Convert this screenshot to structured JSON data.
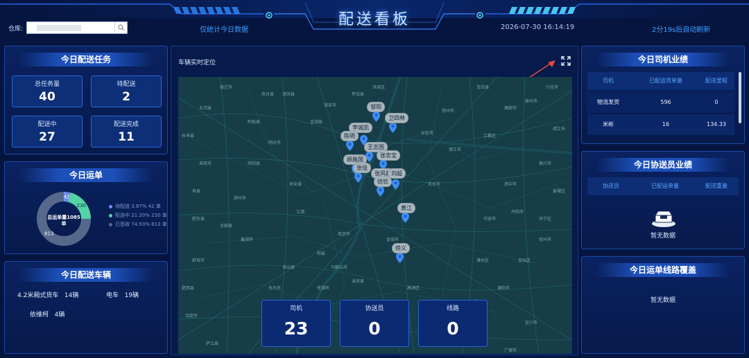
{
  "header": {
    "title": "配送看板",
    "warehouse_label": "仓库:",
    "warehouse_value": "",
    "stat_scope": "仅统计今日数据",
    "datetime": "2026-07-30 16:14:19",
    "refresh": "2分19s后自动刷新"
  },
  "tasks": {
    "title": "今日配送任务",
    "items": [
      {
        "label": "总任务量",
        "value": "40"
      },
      {
        "label": "待配送",
        "value": "2"
      },
      {
        "label": "配送中",
        "value": "27"
      },
      {
        "label": "配送完成",
        "value": "11"
      }
    ]
  },
  "waybill": {
    "title": "今日运单",
    "center_label": "总运单量1085单",
    "slices": [
      {
        "name": "待配送",
        "percent": "3.87%",
        "count": "42 单",
        "value": 42,
        "display": "42",
        "color": "#6e8df0"
      },
      {
        "name": "配送中",
        "percent": "21.20%",
        "count": "230 单",
        "value": 230,
        "display": "230",
        "color": "#53d3a6"
      },
      {
        "name": "已签收",
        "percent": "74.93%",
        "count": "813 单",
        "value": 813,
        "display": "813",
        "color": "#56698c"
      }
    ]
  },
  "vehicles": {
    "title": "今日配送车辆",
    "items": [
      {
        "name": "4.2米厢式货车",
        "count": "14辆"
      },
      {
        "name": "电车",
        "count": "19辆"
      },
      {
        "name": "依维柯",
        "count": "4辆"
      }
    ]
  },
  "map": {
    "title": "车辆实时定位",
    "cities": [
      "宿迁市",
      "淮安市",
      "扬州市",
      "泰州市",
      "镇江市",
      "常州市",
      "南京市",
      "马鞍山市",
      "芜湖市",
      "滁州市",
      "蚌埠市",
      "宣城市",
      "合肥市",
      "淮南市",
      "无为市",
      "巢湖市",
      "句容市",
      "仪征市",
      "天长市",
      "明光市",
      "来安县",
      "金湖县",
      "盱眙县",
      "江浦",
      "全椒县",
      "和县",
      "含山县",
      "当涂县",
      "溧水区",
      "高淳区",
      "溧阳市",
      "丹阳市",
      "金坛区",
      "宜兴市",
      "靖江市",
      "泰兴市",
      "江都区",
      "高邮市",
      "宝应县",
      "兴化市",
      "姜堰区",
      "扬中市",
      "天宁区",
      "肥东县",
      "肥西县",
      "庐江县",
      "南陵县",
      "繁昌县",
      "郎溪县",
      "广德市",
      "洪泽区",
      "泗洪县",
      "五河县",
      "凤阳县",
      "定远县",
      "长丰县",
      "寿县",
      "凤台县",
      "怀远县"
    ],
    "drivers": [
      "邹阳",
      "卫四林",
      "李城凯",
      "陈明",
      "王志国",
      "张忠宝",
      "顾胤国",
      "张佳",
      "张凤超",
      "刘超",
      "徐钦",
      "黄江",
      "徐义"
    ],
    "stats": [
      {
        "label": "司机",
        "value": "23"
      },
      {
        "label": "协送员",
        "value": "0"
      },
      {
        "label": "线路",
        "value": "0"
      }
    ]
  },
  "driver_perf": {
    "title": "今日司机业绩",
    "columns": [
      "司机",
      "已配运货单量",
      "配送里程"
    ],
    "rows": [
      [
        "物流发货",
        "596",
        "0"
      ],
      [
        "米彬",
        "16",
        "134.33"
      ]
    ]
  },
  "assistant_perf": {
    "title": "今日协送员业绩",
    "columns": [
      "协送员",
      "已配运单量",
      "配送重量"
    ],
    "empty": "暂无数据"
  },
  "route_coverage": {
    "title": "今日运单线路覆盖",
    "empty": "暂无数据"
  }
}
